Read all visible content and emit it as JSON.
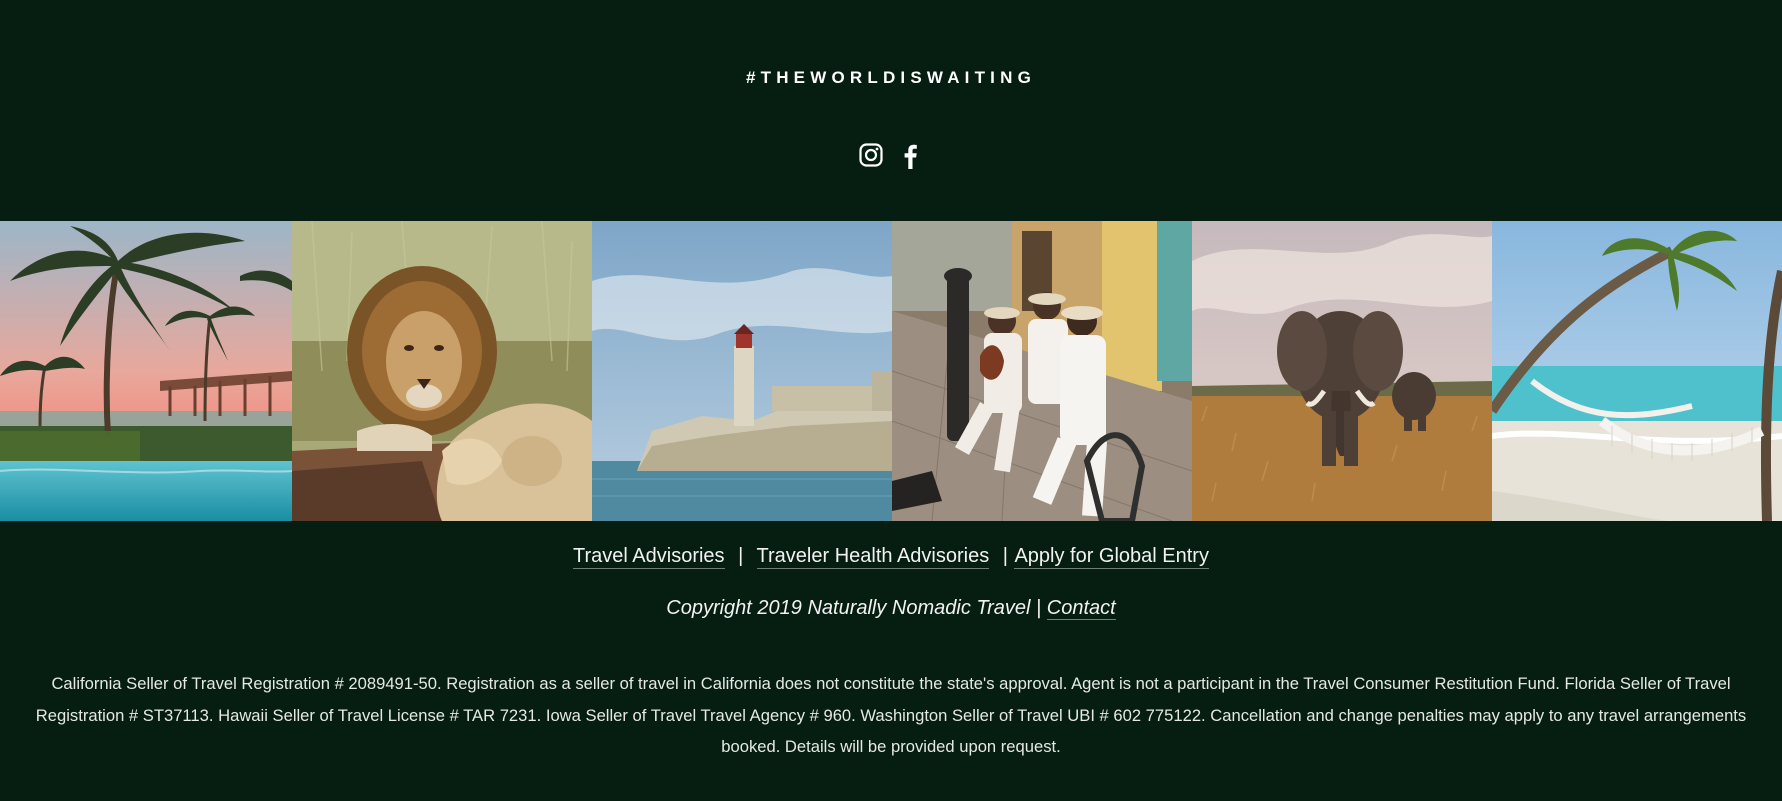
{
  "hashtag": "#THEWORLDISWAITING",
  "social": [
    {
      "icon": "instagram-icon"
    },
    {
      "icon": "facebook-icon"
    }
  ],
  "gallery": [
    {
      "subject": "palm-resort-pool"
    },
    {
      "subject": "lions"
    },
    {
      "subject": "lighthouse-fortress"
    },
    {
      "subject": "street-musicians"
    },
    {
      "subject": "elephants"
    },
    {
      "subject": "beach-hammocks"
    }
  ],
  "links": {
    "travel_advisories": "Travel Advisories",
    "sep1": "|",
    "health_advisories": "Traveler Health Advisories",
    "sep2": "|",
    "global_entry": "Apply for Global Entry"
  },
  "copyright": {
    "text": "Copyright 2019 Naturally Nomadic Travel |",
    "contact": "Contact"
  },
  "legal": "California Seller of Travel Registration # 2089491-50. Registration as a seller of travel in California does not constitute the state's approval. Agent is not a participant in the Travel Consumer Restitution Fund. Florida Seller of Travel Registration # ST37113. Hawaii Seller of Travel License # TAR 7231. Iowa Seller of Travel Travel Agency # 960. Washington Seller of Travel UBI # 602 775122. Cancellation and change penalties may apply to any travel arrangements booked. Details will be provided upon request.",
  "colors": {
    "background": "#061d12",
    "text": "#f2f2f2"
  }
}
